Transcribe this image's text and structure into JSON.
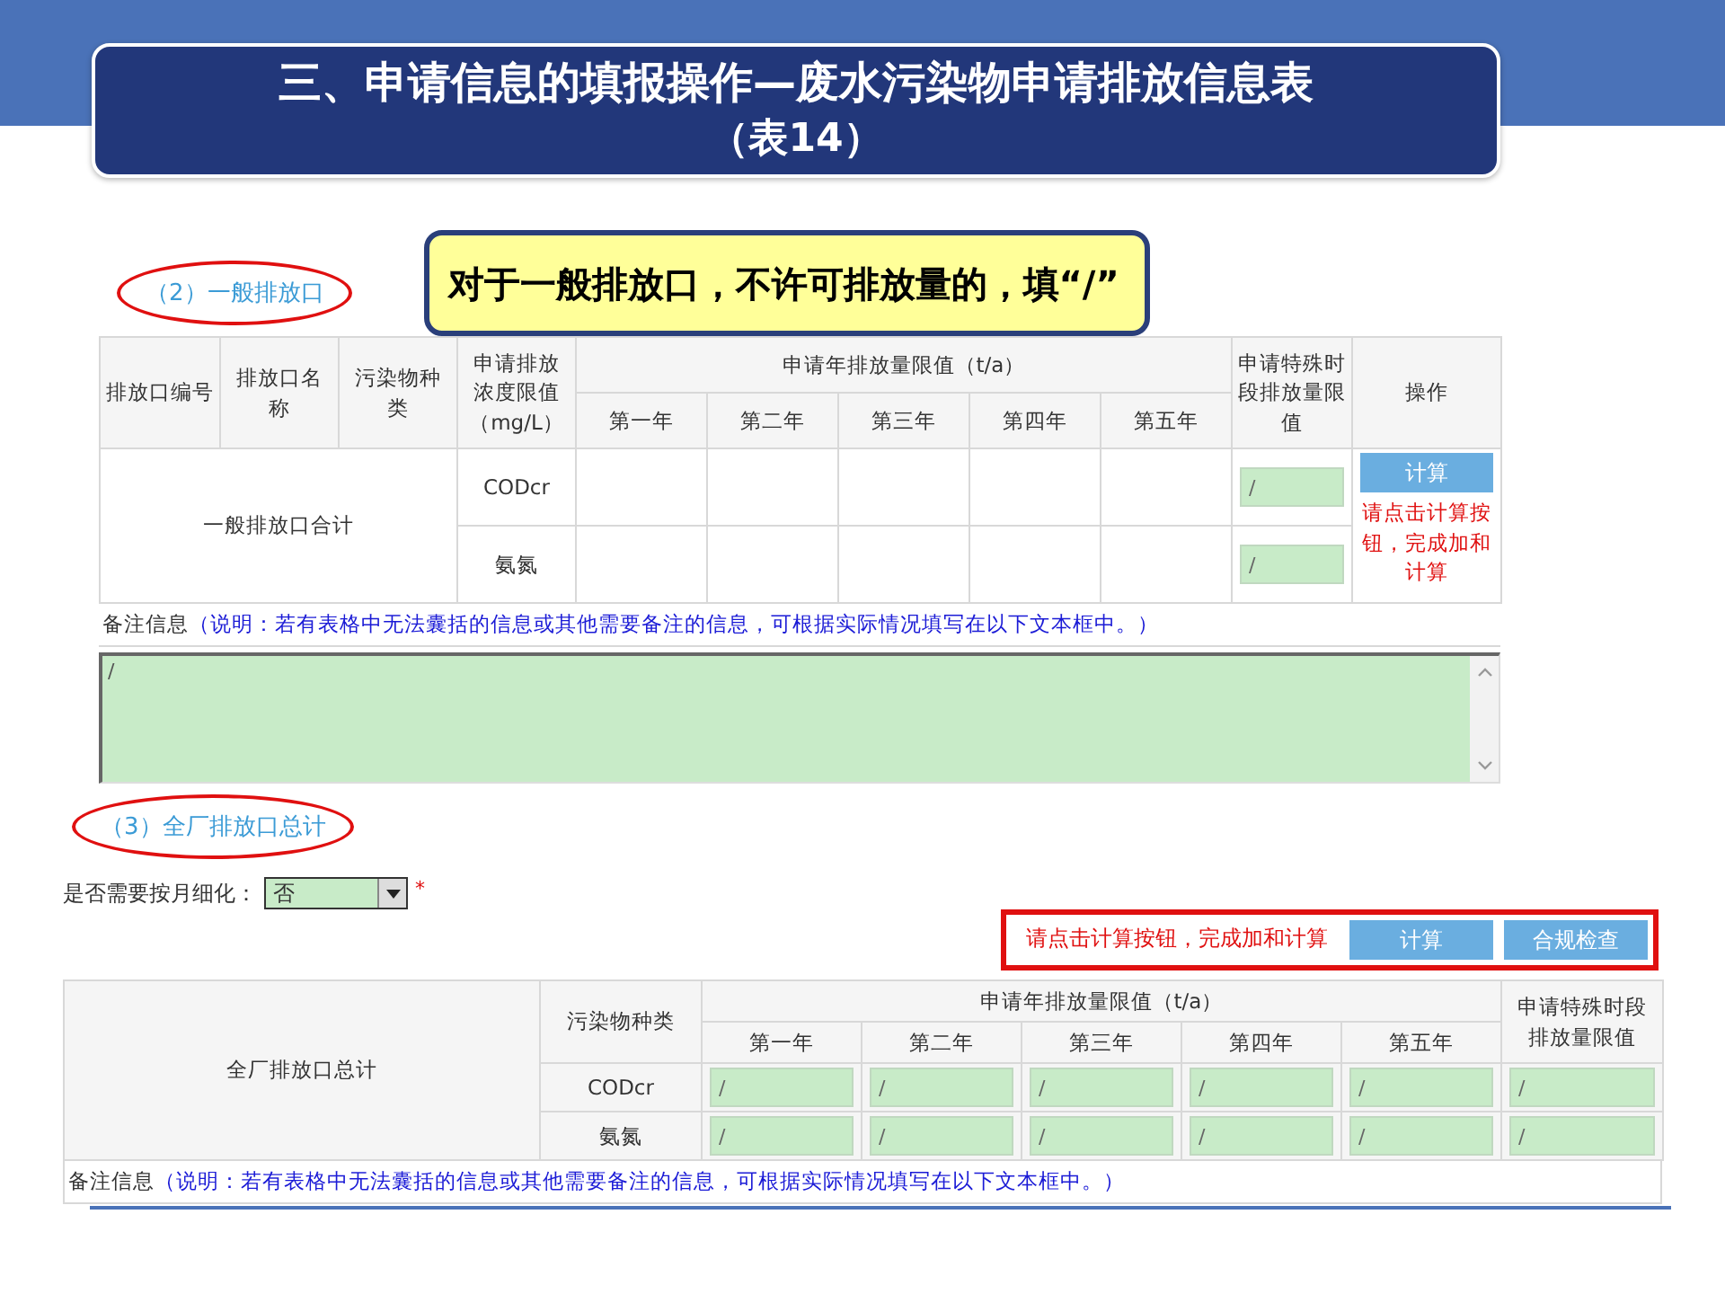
{
  "header": {
    "title": "三、申请信息的填报操作—废水污染物申请排放信息表",
    "subtitle": "（表14）"
  },
  "section1": {
    "heading": "（2）一般排放口",
    "callout": "对于一般排放口，不许可排放量的，填“/”",
    "columns": [
      "排放口编号",
      "排放口名称",
      "污染物种类",
      "申请排放浓度限值（mg/L）"
    ],
    "annual_group": "申请年排放量限值（t/a）",
    "years": [
      "第一年",
      "第二年",
      "第三年",
      "第四年",
      "第五年"
    ],
    "special": "申请特殊时段排放量限值",
    "action": "操作",
    "total_label": "一般排放口合计",
    "rows": [
      {
        "pollutant": "CODcr",
        "special": "/"
      },
      {
        "pollutant": "氨氮",
        "special": "/"
      }
    ],
    "calc_button": "计算",
    "calc_hint": "请点击计算按钮，完成加和计算",
    "note_label": "备注信息",
    "note_hint": "（说明：若有表格中无法囊括的信息或其他需要备注的信息，可根据实际情况填写在以下文本框中。）",
    "note_value": "/"
  },
  "section2": {
    "heading": "（3）全厂排放口总计",
    "monthly_label": "是否需要按月细化：",
    "monthly_value": "否",
    "required_mark": "*",
    "calc_hint": "请点击计算按钮，完成加和计算",
    "calc_button": "计算",
    "check_button": "合规检查",
    "total_label": "全厂排放口总计",
    "pollutant_header": "污染物种类",
    "annual_group": "申请年排放量限值（t/a）",
    "years": [
      "第一年",
      "第二年",
      "第三年",
      "第四年",
      "第五年"
    ],
    "special": "申请特殊时段排放量限值",
    "rows": [
      {
        "pollutant": "CODcr",
        "annual": [
          "/",
          "/",
          "/",
          "/",
          "/"
        ],
        "special": "/"
      },
      {
        "pollutant": "氨氮",
        "annual": [
          "/",
          "/",
          "/",
          "/",
          "/"
        ],
        "special": "/"
      }
    ],
    "note_label": "备注信息",
    "note_hint": "（说明：若有表格中无法囊括的信息或其他需要备注的信息，可根据实际情况填写在以下文本框中。）"
  }
}
